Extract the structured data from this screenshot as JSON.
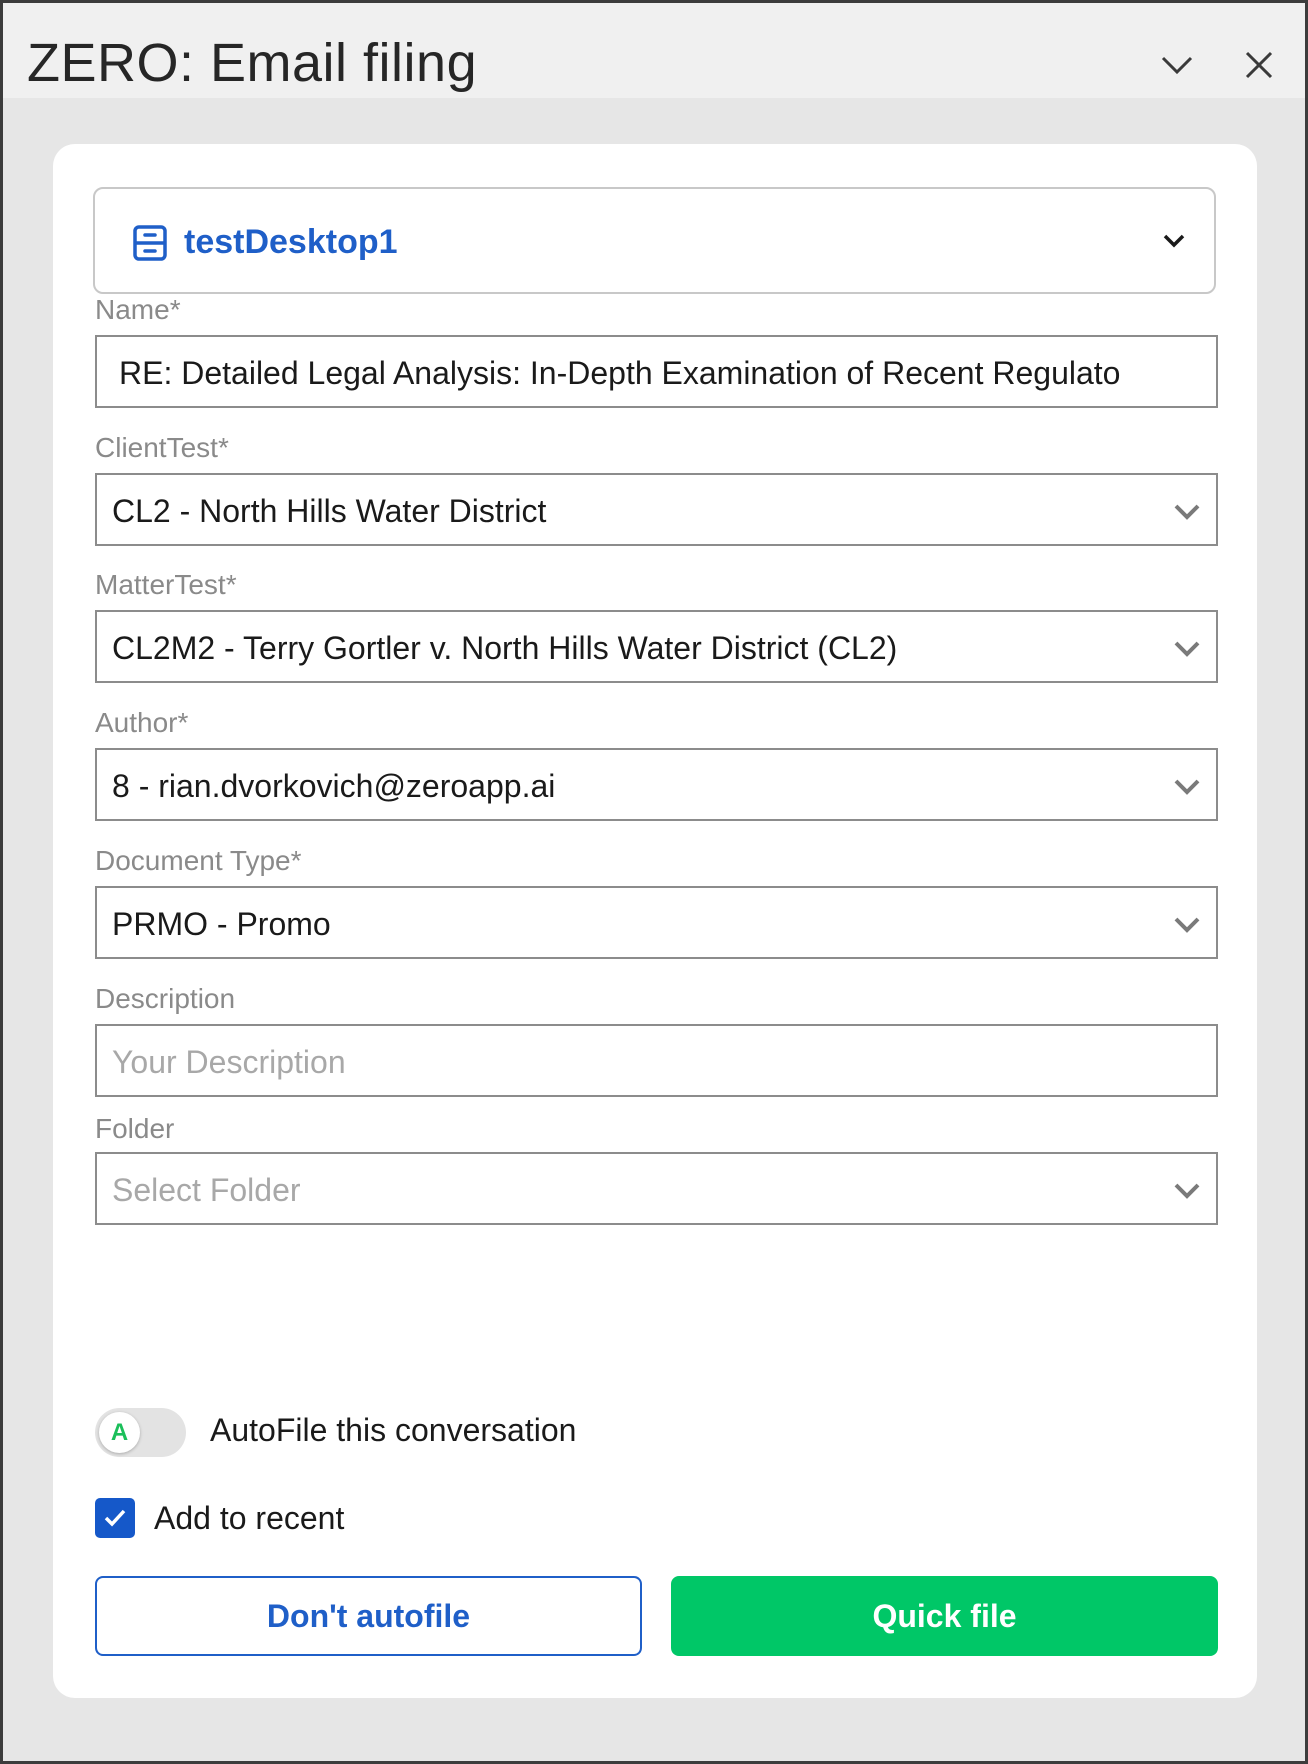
{
  "window": {
    "title": "ZERO: Email filing",
    "collapse_icon": "chevron-down-icon",
    "close_icon": "close-icon"
  },
  "workspace": {
    "icon": "cabinet-icon",
    "label": "testDesktop1",
    "color": "#1f5fc8"
  },
  "fields": {
    "name": {
      "label": "Name*",
      "value": "RE: Detailed Legal Analysis: In-Depth Examination of Recent Regulato"
    },
    "client": {
      "label": "ClientTest*",
      "value": "CL2 - North Hills Water District"
    },
    "matter": {
      "label": "MatterTest*",
      "value": "CL2M2 - Terry Gortler v. North Hills Water District (CL2)"
    },
    "author": {
      "label": "Author*",
      "value": "8 - rian.dvorkovich@zeroapp.ai"
    },
    "document_type": {
      "label": "Document Type*",
      "value": "PRMO - Promo"
    },
    "description": {
      "label": "Description",
      "placeholder": "Your Description"
    },
    "folder": {
      "label": "Folder",
      "placeholder": "Select Folder"
    }
  },
  "autofile_toggle": {
    "knob_letter": "A",
    "label": "AutoFile this conversation",
    "enabled": false
  },
  "add_to_recent": {
    "label": "Add to recent",
    "checked": true
  },
  "buttons": {
    "dont_autofile": "Don't autofile",
    "quick_file": "Quick file"
  },
  "colors": {
    "accent_blue": "#1f5fc8",
    "primary_green": "#00c767",
    "checkbox_blue": "#1558c9"
  }
}
